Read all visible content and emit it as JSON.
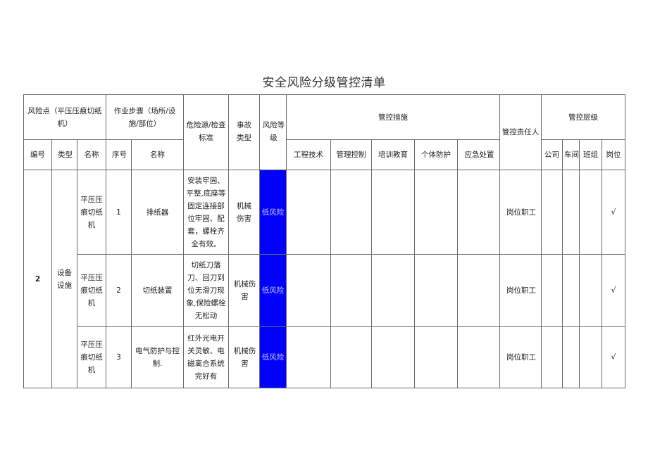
{
  "title": "安全风险分级管控清单",
  "header": {
    "risk_point": "风险点（平压压痕切纸机）",
    "work_step": "作业步骤（场所/设施/部位）",
    "hazard_standard": "危险源/检查标准",
    "accident_type": "事故类型",
    "risk_level": "风险等级",
    "control_measures": "管控措施",
    "responsible_person": "管控责任人",
    "control_level": "管控层级",
    "sub": {
      "number": "编号",
      "type": "类型",
      "name": "名称",
      "seq": "序号",
      "step_name": "名称",
      "engineering": "工程技术",
      "management": "管理控制",
      "training": "培训教育",
      "ppe": "个体防护",
      "emergency": "应急处置",
      "company": "公司",
      "workshop": "车间",
      "team": "班组",
      "post": "岗位"
    }
  },
  "group": {
    "number": "2",
    "type": "设备设施"
  },
  "rows": [
    {
      "name": "平压压痕切纸机",
      "seq": "1",
      "step_name": "排纸器",
      "hazard": "安装牢固、平整,底座等固定连接部位牢固、配套，螺栓齐全有效。",
      "accident": "机械伤害",
      "risk": "低风险",
      "engineering": "",
      "management": "",
      "training": "",
      "ppe": "",
      "emergency": "",
      "responsible": "岗位职工",
      "company": "",
      "workshop": "",
      "team": "",
      "post": "√"
    },
    {
      "name": "平压压痕切纸机",
      "seq": "2",
      "step_name": "切纸装置",
      "hazard": "切纸刀落刀、回刀到位无滑刀现象,保险螺栓无松动",
      "accident": "机械伤害",
      "risk": "低风险",
      "engineering": "",
      "management": "",
      "training": "",
      "ppe": "",
      "emergency": "",
      "responsible": "岗位职工",
      "company": "",
      "workshop": "",
      "team": "",
      "post": "√"
    },
    {
      "name": "平压压痕切纸机",
      "seq": "3",
      "step_name": "电气防护与控制.",
      "hazard": "红外光电开关灵敏、电磁离合系统完好有",
      "accident": "机械伤害",
      "risk": "低风险",
      "engineering": "",
      "management": "",
      "training": "",
      "ppe": "",
      "emergency": "",
      "responsible": "岗位职工",
      "company": "",
      "workshop": "",
      "team": "",
      "post": "√"
    }
  ],
  "colors": {
    "risk_low_bg": "#0000ff",
    "risk_low_text": "#c9c3f2"
  }
}
